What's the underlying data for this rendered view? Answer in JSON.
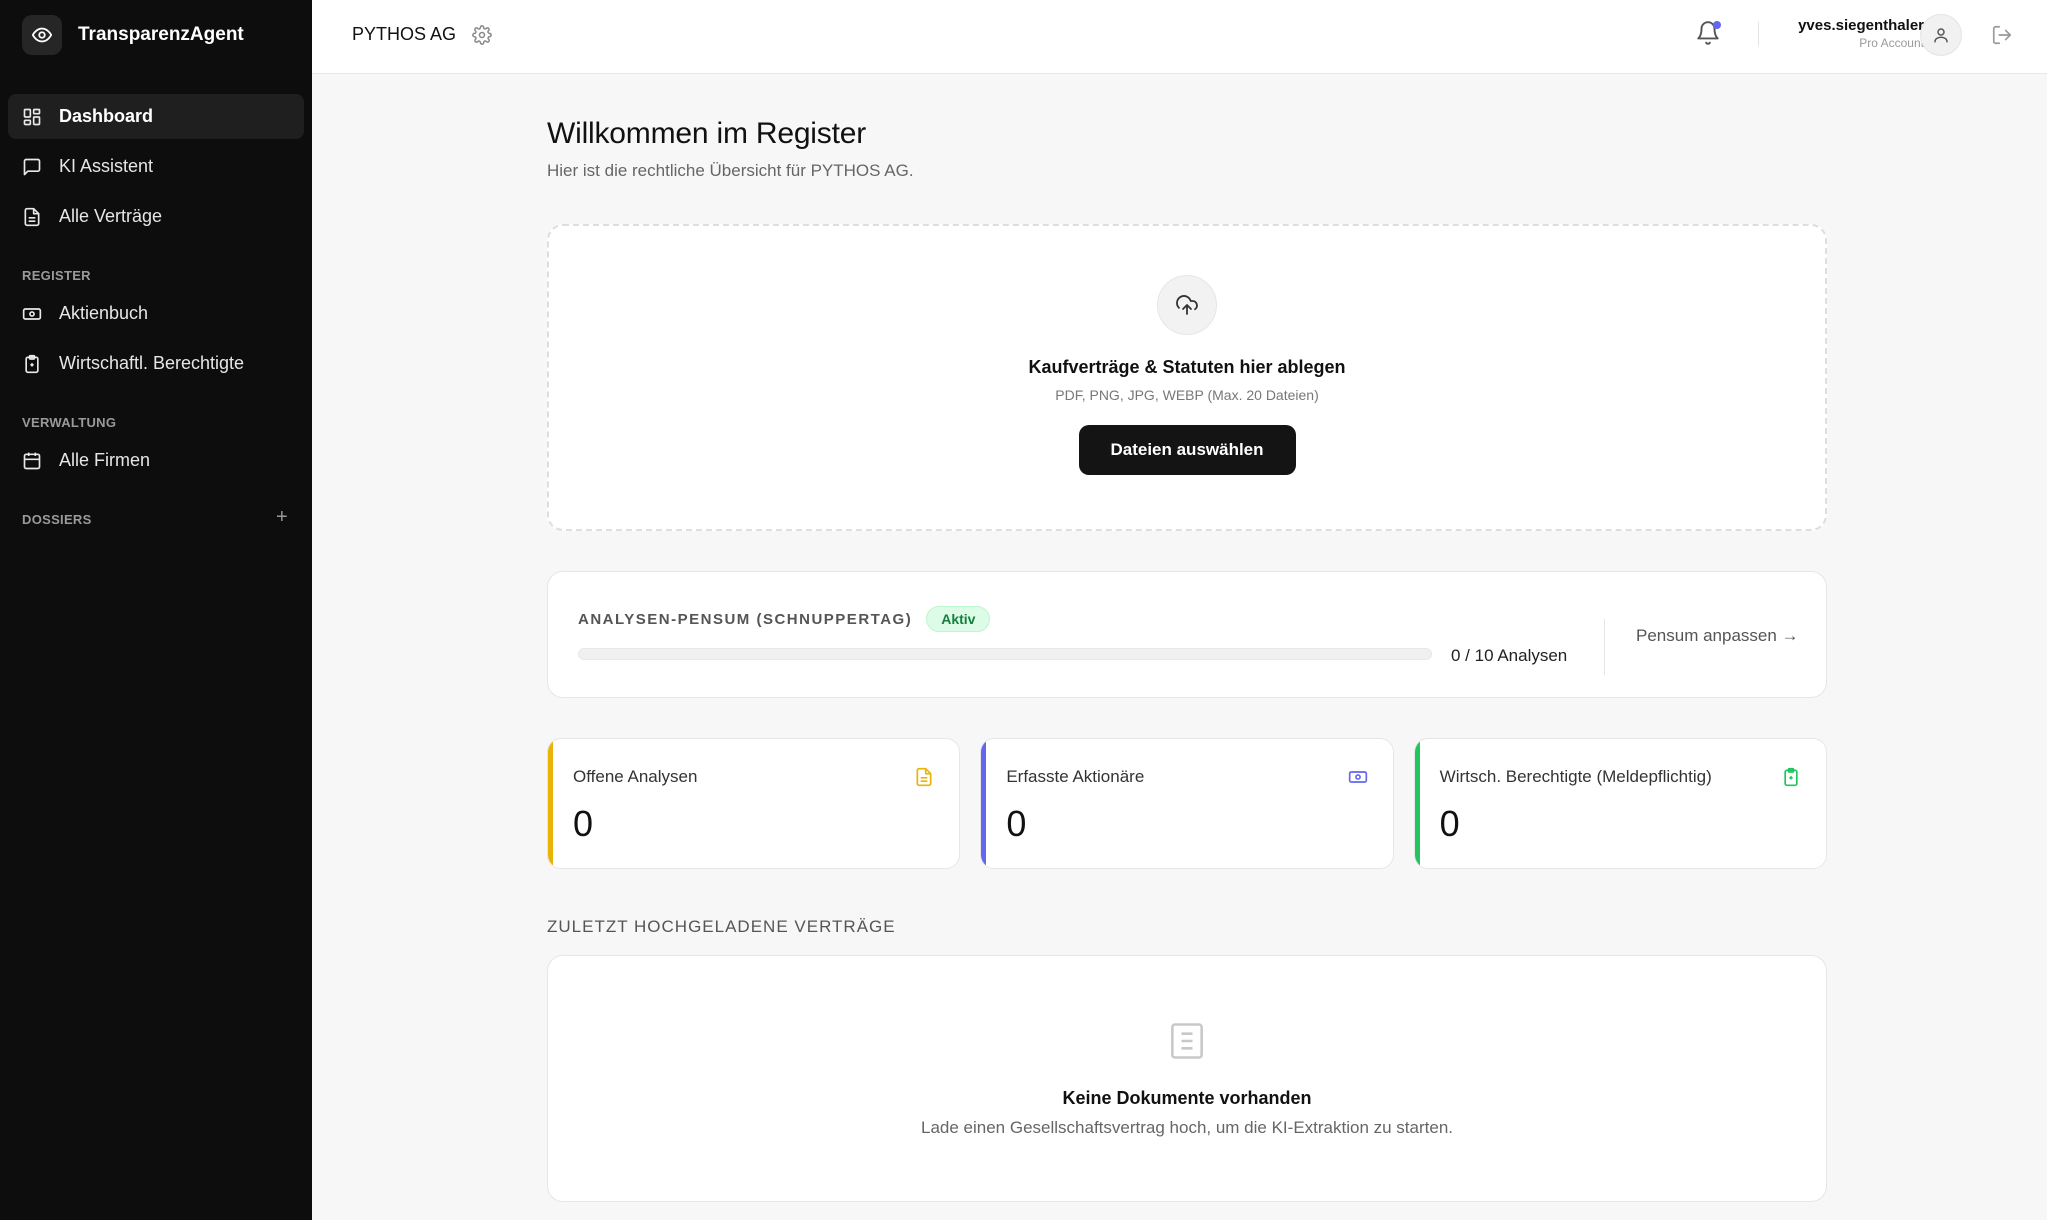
{
  "app": {
    "name": "TransparenzAgent"
  },
  "sidebar": {
    "items": [
      {
        "label": "Dashboard"
      },
      {
        "label": "KI Assistent"
      },
      {
        "label": "Alle Verträge"
      }
    ],
    "sections": [
      {
        "label": "REGISTER",
        "items": [
          {
            "label": "Aktienbuch"
          },
          {
            "label": "Wirtschaftl. Berechtigte"
          }
        ]
      },
      {
        "label": "VERWALTUNG",
        "items": [
          {
            "label": "Alle Firmen"
          }
        ]
      },
      {
        "label": "DOSSIERS",
        "add": "+"
      }
    ]
  },
  "topbar": {
    "company": "PYTHOS AG",
    "user": {
      "name": "yves.siegenthaler",
      "plan": "Pro Account"
    }
  },
  "main": {
    "title": "Willkommen im Register",
    "subtitle": "Hier ist die rechtliche Übersicht für PYTHOS AG.",
    "dropzone": {
      "title": "Kaufverträge & Statuten hier ablegen",
      "subtitle": "PDF, PNG, JPG, WEBP (Max. 20 Dateien)",
      "button": "Dateien auswählen"
    },
    "quota": {
      "label": "ANALYSEN-PENSUM (SCHNUPPERTAG)",
      "badge": "Aktiv",
      "used": 0,
      "total": 10,
      "count_text": "0 / 10 Analysen",
      "link": "Pensum anpassen →"
    },
    "stats": [
      {
        "label": "Offene Analysen",
        "value": "0",
        "color": "#eab308",
        "icon": "document-icon"
      },
      {
        "label": "Erfasste Aktionäre",
        "value": "0",
        "color": "#6366f1",
        "icon": "banknote-icon"
      },
      {
        "label": "Wirtsch. Berechtigte (Meldepflichtig)",
        "value": "0",
        "color": "#22c55e",
        "icon": "clipboard-icon"
      }
    ],
    "recent": {
      "heading": "ZULETZT HOCHGELADENE VERTRÄGE",
      "empty_title": "Keine Dokumente vorhanden",
      "empty_subtitle": "Lade einen Gesellschaftsvertrag hoch, um die KI-Extraktion zu starten."
    }
  }
}
